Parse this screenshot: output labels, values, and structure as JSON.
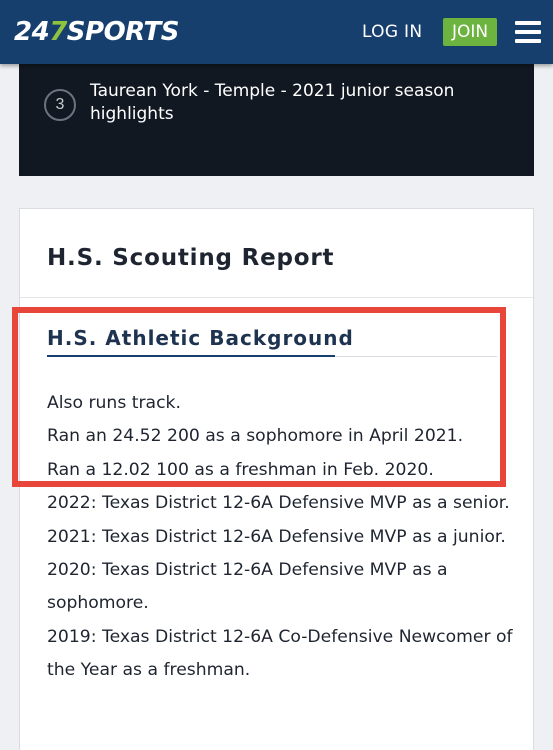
{
  "header": {
    "logo_prefix": "24",
    "logo_seven": "7",
    "logo_suffix": "SPORTS",
    "login_label": "LOG IN",
    "join_label": "JOIN",
    "menu_icon": "hamburger-menu-icon",
    "brand_color": "#163f6e",
    "join_color": "#6cb33f"
  },
  "playlist": {
    "item_number": "3",
    "item_title": "Taurean York - Temple - 2021 junior season highlights"
  },
  "scouting": {
    "title": "H.S. Scouting Report",
    "section_title": "H.S. Athletic Background",
    "lines": [
      "Also runs track.",
      "Ran an 24.52 200 as a sophomore in April 2021.",
      "Ran a 12.02 100 as a freshman in Feb. 2020.",
      "2022: Texas District 12-6A Defensive MVP as a senior.",
      "2021: Texas District 12-6A Defensive MVP as a junior.",
      "2020: Texas District 12-6A Defensive MVP as a sophomore.",
      "2019: Texas District 12-6A Co-Defensive Newcomer of the Year as a freshman."
    ]
  },
  "annotation": {
    "color": "#e8463a"
  }
}
